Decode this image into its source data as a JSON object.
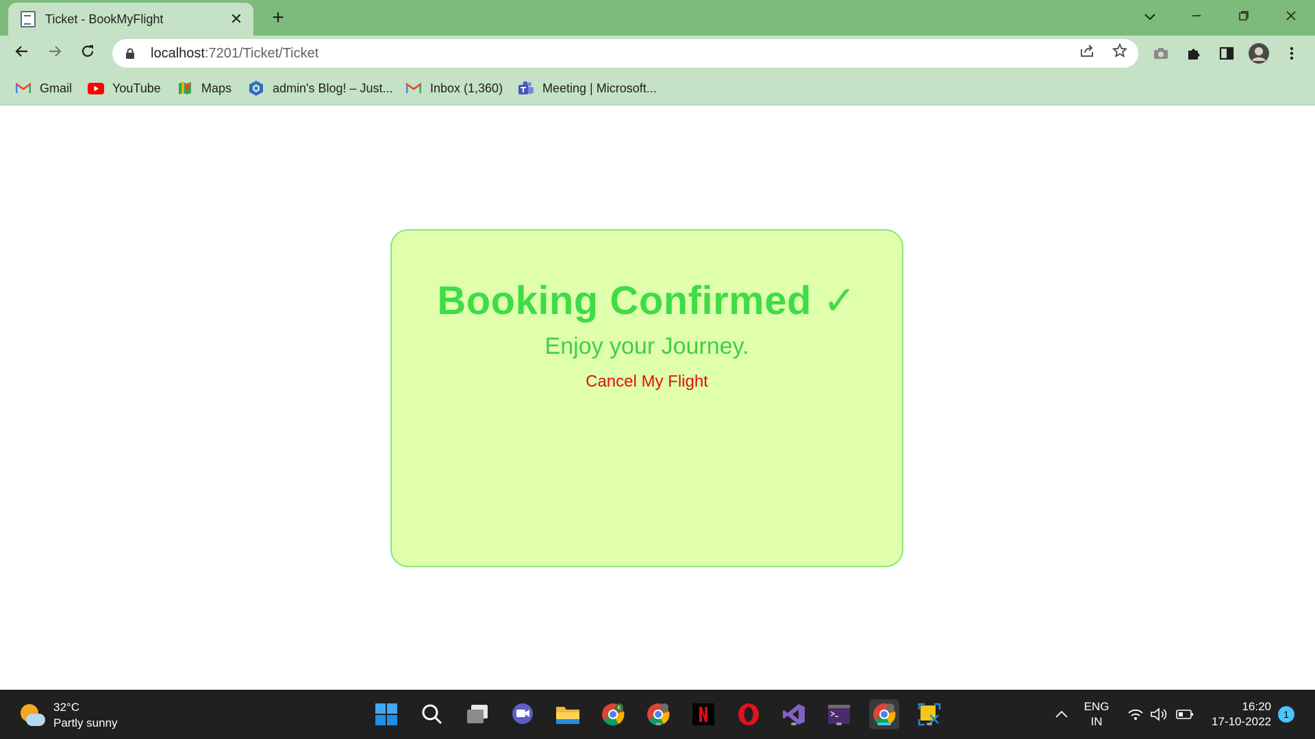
{
  "browser": {
    "tab_title": "Ticket - BookMyFlight",
    "tab_close": "✕",
    "new_tab": "+",
    "url_host": "localhost",
    "url_path": ":7201/Ticket/Ticket",
    "bookmarks": [
      {
        "label": "Gmail",
        "icon": "gmail-icon"
      },
      {
        "label": "YouTube",
        "icon": "youtube-icon"
      },
      {
        "label": "Maps",
        "icon": "maps-icon"
      },
      {
        "label": "admin's Blog! – Just...",
        "icon": "blog-icon"
      },
      {
        "label": "Inbox (1,360)",
        "icon": "gmail-icon"
      },
      {
        "label": "Meeting | Microsoft...",
        "icon": "teams-icon"
      }
    ]
  },
  "page": {
    "heading": "Booking Confirmed ✓",
    "subheading": "Enjoy your Journey.",
    "cancel_link": "Cancel My Flight",
    "colors": {
      "card_bg": "#dfffad",
      "card_border": "#8fe07a",
      "heading": "#3fdc47",
      "cancel": "#e01010"
    }
  },
  "taskbar": {
    "temperature": "32°C",
    "weather": "Partly sunny",
    "language_top": "ENG",
    "language_bottom": "IN",
    "time": "16:20",
    "date": "17-10-2022",
    "notification_count": "1"
  }
}
